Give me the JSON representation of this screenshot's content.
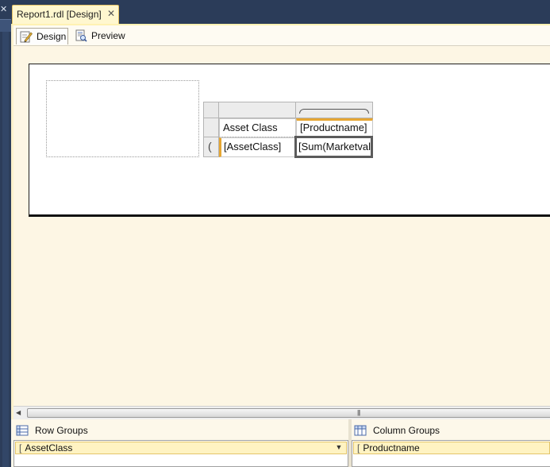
{
  "document_tab": {
    "title": "Report1.rdl [Design]",
    "close_glyph": "✕"
  },
  "view_tabs": [
    {
      "label": "Design",
      "icon": "design-pencil-icon",
      "selected": true
    },
    {
      "label": "Preview",
      "icon": "preview-report-icon",
      "selected": false
    }
  ],
  "tablix": {
    "header_row": {
      "col1": "Asset Class",
      "col2": "[Productname]"
    },
    "detail_row": {
      "col1": "[AssetClass]",
      "col2": "[Sum(Marketval"
    }
  },
  "groups": {
    "row_groups": {
      "title": "Row Groups",
      "icon": "row-groups-icon",
      "items": [
        "AssetClass"
      ]
    },
    "column_groups": {
      "title": "Column Groups",
      "icon": "column-groups-icon",
      "items": [
        "Productname"
      ]
    }
  },
  "colors": {
    "accent_orange": "#e6a632",
    "tab_active_bg": "#fff7cf",
    "chrome_dark": "#2b3c59",
    "canvas_bg": "#fdf6e4"
  }
}
